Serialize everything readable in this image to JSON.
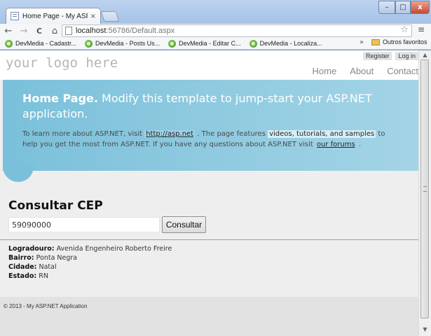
{
  "browser": {
    "tab_title": "Home Page - My ASP.NET",
    "tab_close": "×",
    "window_controls": {
      "minimize": "–",
      "maximize": "□",
      "close": "x"
    },
    "url_host": "localhost",
    "url_rest": ":56786/Default.aspx",
    "nav": {
      "back": "←",
      "forward": "→",
      "reload": "C",
      "home": "⌂"
    },
    "star": "☆",
    "menu": "≡",
    "bookmarks": [
      {
        "label": "DevMedia - Cadastr..."
      },
      {
        "label": "DevMedia - Posts Us..."
      },
      {
        "label": "DevMedia - Editar C..."
      },
      {
        "label": "DevMedia - Localiza..."
      }
    ],
    "bookmarks_overflow": "»",
    "other_bookmarks": "Outros favoritos"
  },
  "site": {
    "logo": "your logo here",
    "login_links": [
      "Register",
      "Log in"
    ],
    "nav": [
      "Home",
      "About",
      "Contact"
    ]
  },
  "featured": {
    "title_bold": "Home Page.",
    "title_rest": " Modify this template to jump-start your ASP.NET application.",
    "text_1": "To learn more about ASP.NET, visit ",
    "link_1": "http://asp.net",
    "text_2": " . The page features ",
    "highlight": "videos, tutorials, and samples",
    "text_3": " to help you get the most from ASP.NET. If you have any questions about ASP.NET visit ",
    "link_2": "our forums",
    "text_4": " ."
  },
  "cep": {
    "title": "Consultar CEP",
    "input_value": "59090000",
    "button_label": "Consultar"
  },
  "address": {
    "logradouro_label": "Logradouro:",
    "logradouro_value": " Avenida Engenheiro Roberto Freire",
    "bairro_label": "Bairro:",
    "bairro_value": " Ponta Negra",
    "cidade_label": "Cidade:",
    "cidade_value": " Natal",
    "estado_label": "Estado:",
    "estado_value": " RN"
  },
  "footer": {
    "text": "© 2013 - My ASP.NET Application"
  },
  "scrollbar": {
    "up": "▲",
    "down": "▼"
  }
}
